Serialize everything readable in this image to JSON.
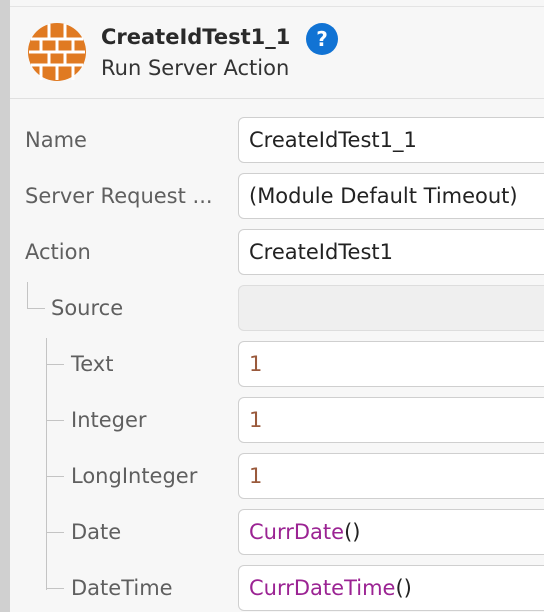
{
  "header": {
    "title": "CreateIdTest1_1",
    "subtitle": "Run Server Action",
    "help_label": "?",
    "logo_icon": "server-action-grid-icon",
    "logo_color": "#e07a22",
    "help_color": "#1173d4"
  },
  "properties": [
    {
      "label": "Name",
      "value": "CreateIdTest1_1"
    },
    {
      "label": "Server Request ...",
      "value": "(Module Default Timeout)"
    },
    {
      "label": "Action",
      "value": "CreateIdTest1"
    },
    {
      "label": "Source",
      "value": ""
    }
  ],
  "parameters": [
    {
      "label": "Text",
      "value": "1"
    },
    {
      "label": "Integer",
      "value": "1"
    },
    {
      "label": "LongInteger",
      "value": "1"
    },
    {
      "label": "Date",
      "fn": "CurrDate",
      "args": "()"
    },
    {
      "label": "DateTime",
      "fn": "CurrDateTime",
      "args": "()"
    }
  ],
  "colors": {
    "number_literal": "#9a5a3c",
    "function_name": "#9b2393"
  }
}
